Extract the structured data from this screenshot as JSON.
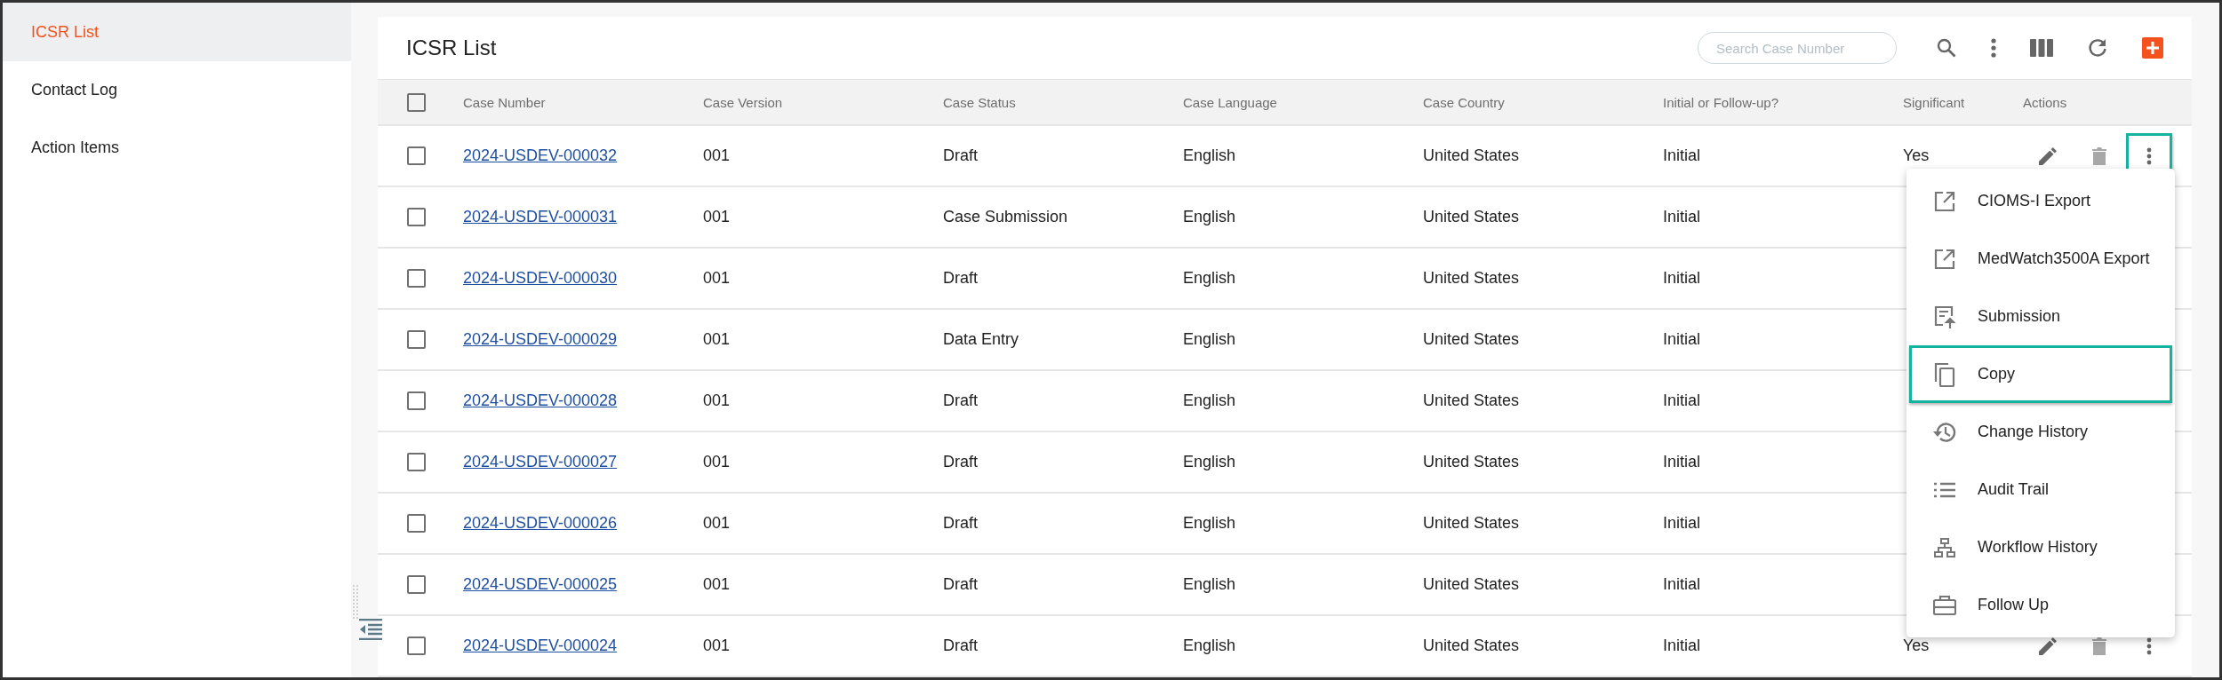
{
  "sidebar": {
    "items": [
      {
        "label": "ICSR List",
        "selected": true
      },
      {
        "label": "Contact Log",
        "selected": false
      },
      {
        "label": "Action Items",
        "selected": false
      }
    ]
  },
  "page": {
    "title": "ICSR List",
    "search": {
      "placeholder": "Search Case Number"
    }
  },
  "table": {
    "select_all_checked": false,
    "columns": [
      "Case Number",
      "Case Version",
      "Case Status",
      "Case Language",
      "Case Country",
      "Initial or Follow-up?",
      "Significant",
      "Actions"
    ],
    "rows": [
      {
        "checked": false,
        "case_number": "2024-USDEV-000032",
        "version": "001",
        "status": "Draft",
        "language": "English",
        "country": "United States",
        "initial": "Initial",
        "significant": "Yes",
        "actions": {
          "menu_open": true
        }
      },
      {
        "checked": false,
        "case_number": "2024-USDEV-000031",
        "version": "001",
        "status": "Case Submission",
        "language": "English",
        "country": "United States",
        "initial": "Initial"
      },
      {
        "checked": false,
        "case_number": "2024-USDEV-000030",
        "version": "001",
        "status": "Draft",
        "language": "English",
        "country": "United States",
        "initial": "Initial"
      },
      {
        "checked": false,
        "case_number": "2024-USDEV-000029",
        "version": "001",
        "status": "Data Entry",
        "language": "English",
        "country": "United States",
        "initial": "Initial"
      },
      {
        "checked": false,
        "case_number": "2024-USDEV-000028",
        "version": "001",
        "status": "Draft",
        "language": "English",
        "country": "United States",
        "initial": "Initial"
      },
      {
        "checked": false,
        "case_number": "2024-USDEV-000027",
        "version": "001",
        "status": "Draft",
        "language": "English",
        "country": "United States",
        "initial": "Initial"
      },
      {
        "checked": false,
        "case_number": "2024-USDEV-000026",
        "version": "001",
        "status": "Draft",
        "language": "English",
        "country": "United States",
        "initial": "Initial"
      },
      {
        "checked": false,
        "case_number": "2024-USDEV-000025",
        "version": "001",
        "status": "Draft",
        "language": "English",
        "country": "United States",
        "initial": "Initial"
      },
      {
        "checked": false,
        "case_number": "2024-USDEV-000024",
        "version": "001",
        "status": "Draft",
        "language": "English",
        "country": "United States",
        "initial": "Initial",
        "significant": "Yes",
        "actions": {
          "menu_open": false
        }
      }
    ]
  },
  "menu": {
    "items": [
      {
        "label": "CIOMS-I Export",
        "kind": "export",
        "highlighted": false
      },
      {
        "label": "MedWatch3500A Export",
        "kind": "export",
        "highlighted": false
      },
      {
        "label": "Submission",
        "kind": "submission",
        "highlighted": false
      },
      {
        "label": "Copy",
        "kind": "copy",
        "highlighted": true
      },
      {
        "label": "Change History",
        "kind": "history",
        "highlighted": false
      },
      {
        "label": "Audit Trail",
        "kind": "list",
        "highlighted": false
      },
      {
        "label": "Workflow History",
        "kind": "workflow",
        "highlighted": false
      },
      {
        "label": "Follow Up",
        "kind": "briefcase",
        "highlighted": false
      }
    ]
  }
}
